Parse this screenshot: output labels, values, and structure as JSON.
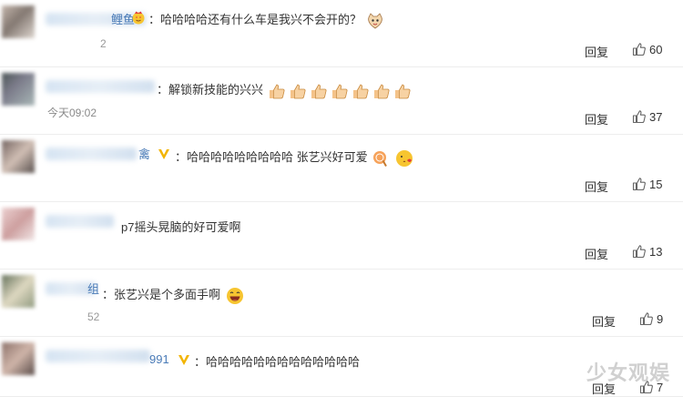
{
  "watermark": "少女观娱",
  "colors": {
    "name": "#4a7bb7",
    "text": "#333333",
    "muted": "#999999",
    "vip": "#f2b400"
  },
  "comments": [
    {
      "name_suffix": "鲤鱼",
      "badge_icon": "crown-heart-eyes-emoji",
      "colon": "：",
      "text": "哈哈哈哈还有什么车是我兴不会开的？",
      "emoji_after": "cat-emoji",
      "time": "2",
      "reply_label": "回复",
      "like_count": "60"
    },
    {
      "name_suffix": "",
      "colon": "：",
      "text": "解锁新技能的兴兴",
      "emoji_after": "thumbs-up-emoji x7",
      "time": "今天09:02",
      "reply_label": "回复",
      "like_count": "37"
    },
    {
      "name_suffix": "禽",
      "badge_icon": "vip-v-badge",
      "colon": "：",
      "text": "哈哈哈哈哈哈哈哈哈 张艺兴好可爱",
      "emoji_after": "lollipop-kiss-emoji",
      "time": "",
      "reply_label": "回复",
      "like_count": "15"
    },
    {
      "name_suffix": "",
      "colon": "",
      "text": "p7摇头晃脑的好可爱啊",
      "time": "",
      "reply_label": "回复",
      "like_count": "13"
    },
    {
      "name_suffix": "组",
      "colon": "：",
      "text": "张艺兴是个多面手啊",
      "emoji_after": "laughing-emoji",
      "time": "52",
      "reply_label": "回复",
      "like_count": "9"
    },
    {
      "name_suffix": "991",
      "badge_icon": "vip-v-badge",
      "colon": "：",
      "text": "哈哈哈哈哈哈哈哈哈哈哈哈哈",
      "time": "",
      "reply_label": "回复",
      "like_count": "7"
    }
  ]
}
